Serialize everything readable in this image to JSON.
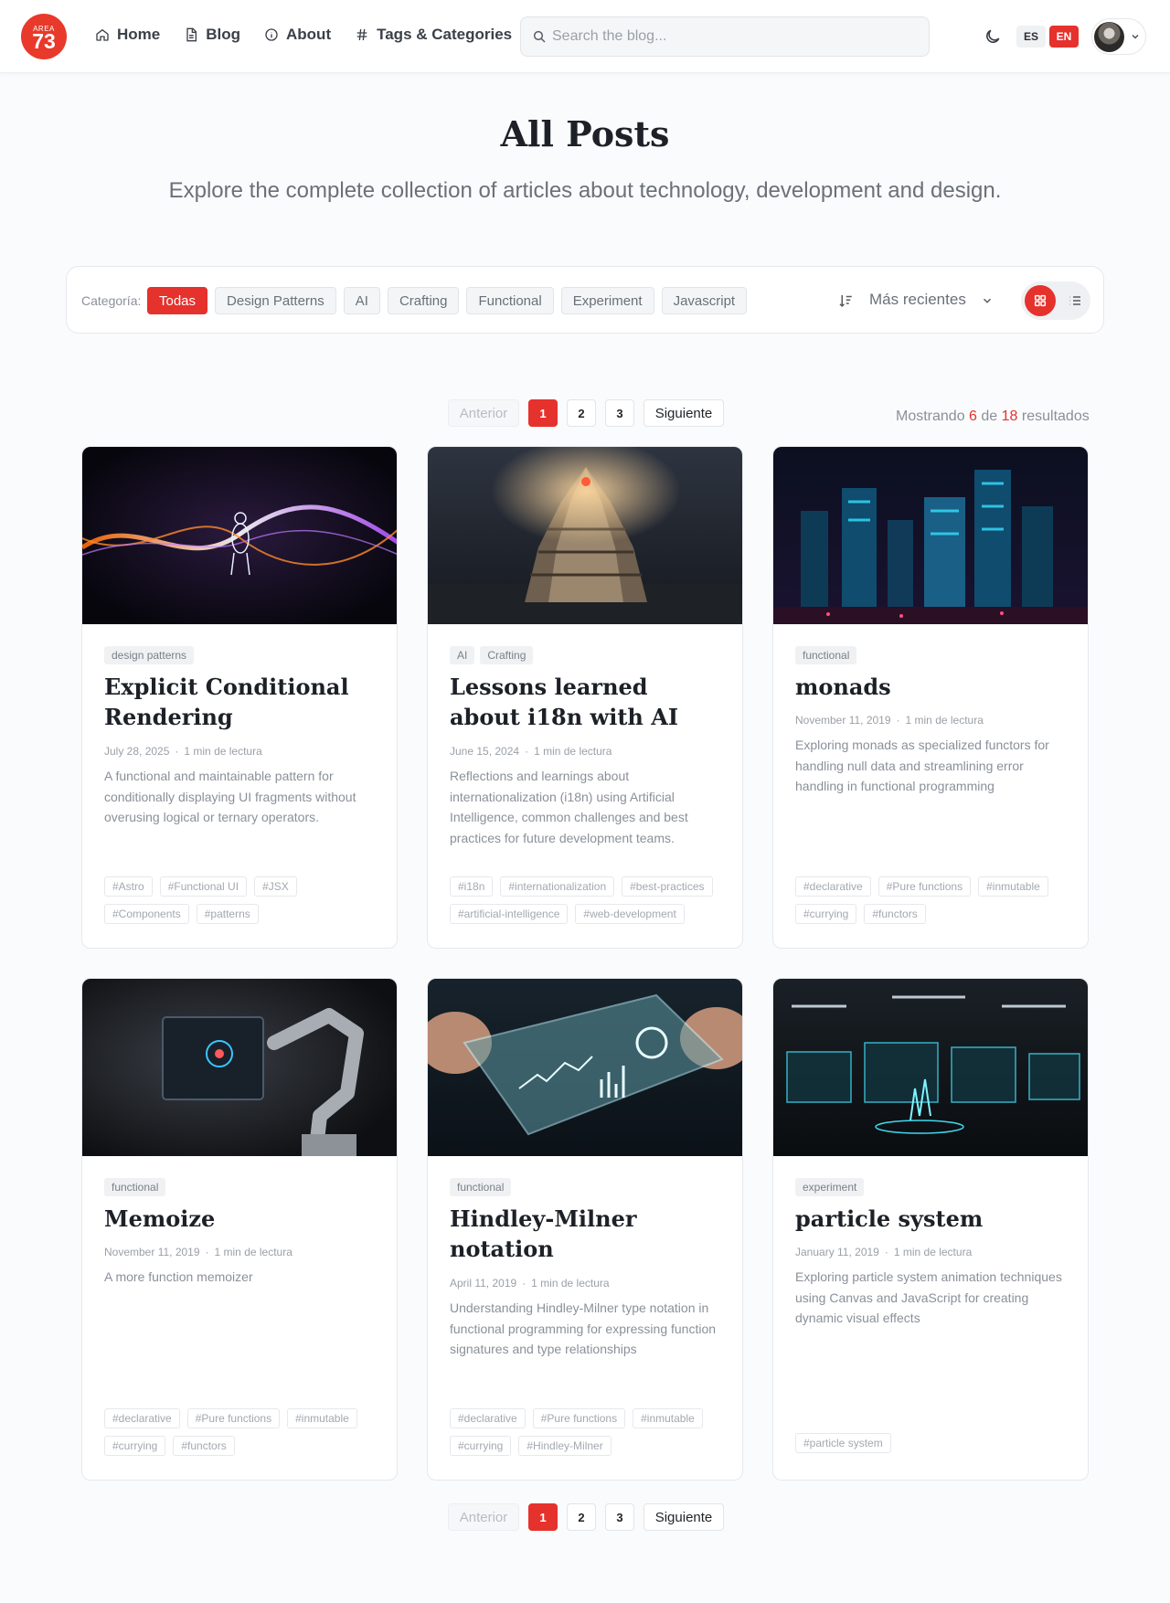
{
  "logo": {
    "small": "AREA",
    "number": "73"
  },
  "nav": [
    {
      "label": "Home",
      "icon": "home-icon"
    },
    {
      "label": "Blog",
      "icon": "document-icon"
    },
    {
      "label": "About",
      "icon": "info-icon"
    },
    {
      "label": "Tags & Categories",
      "icon": "hash-icon"
    }
  ],
  "search": {
    "placeholder": "Search the blog..."
  },
  "lang": {
    "es": "ES",
    "en": "EN",
    "active": "EN"
  },
  "hero": {
    "title": "All Posts",
    "subtitle": "Explore the complete collection of articles about technology, development and design."
  },
  "filter": {
    "label": "Categoría:",
    "chips": [
      "Todas",
      "Design Patterns",
      "AI",
      "Crafting",
      "Functional",
      "Experiment",
      "Javascript"
    ],
    "active": "Todas",
    "sort_label": "Más recientes",
    "view": "grid"
  },
  "pagination": {
    "prev": "Anterior",
    "pages": [
      "1",
      "2",
      "3"
    ],
    "current": "1",
    "next": "Siguiente"
  },
  "results": {
    "prefix": "Mostrando",
    "shown": "6",
    "middle": "de",
    "total": "18",
    "suffix": "resultados"
  },
  "colors": {
    "accent": "#e5322d",
    "text": "#1d2127",
    "muted": "#8a9099"
  },
  "posts": [
    {
      "categories": [
        "design patterns"
      ],
      "title": "Explicit Conditional Rendering",
      "date": "July 28, 2025",
      "read": "1 min de lectura",
      "excerpt": "A functional and maintainable pattern for conditionally displaying UI fragments without overusing logical or ternary operators.",
      "tags": [
        "#Astro",
        "#Functional UI",
        "#JSX",
        "#Components",
        "#patterns"
      ]
    },
    {
      "categories": [
        "AI",
        "Crafting"
      ],
      "title": "Lessons learned about i18n with AI",
      "date": "June 15, 2024",
      "read": "1 min de lectura",
      "excerpt": "Reflections and learnings about internationalization (i18n) using Artificial Intelligence, common challenges and best practices for future development teams.",
      "tags": [
        "#i18n",
        "#internationalization",
        "#best-practices",
        "#artificial-intelligence",
        "#web-development"
      ]
    },
    {
      "categories": [
        "functional"
      ],
      "title": "monads",
      "date": "November 11, 2019",
      "read": "1 min de lectura",
      "excerpt": "Exploring monads as specialized functors for handling null data and streamlining error handling in functional programming",
      "tags": [
        "#declarative",
        "#Pure functions",
        "#inmutable",
        "#currying",
        "#functors"
      ]
    },
    {
      "categories": [
        "functional"
      ],
      "title": "Memoize",
      "date": "November 11, 2019",
      "read": "1 min de lectura",
      "excerpt": "A more function memoizer",
      "tags": [
        "#declarative",
        "#Pure functions",
        "#inmutable",
        "#currying",
        "#functors"
      ]
    },
    {
      "categories": [
        "functional"
      ],
      "title": "Hindley-Milner notation",
      "date": "April 11, 2019",
      "read": "1 min de lectura",
      "excerpt": "Understanding Hindley-Milner type notation in functional programming for expressing function signatures and type relationships",
      "tags": [
        "#declarative",
        "#Pure functions",
        "#inmutable",
        "#currying",
        "#Hindley-Milner"
      ]
    },
    {
      "categories": [
        "experiment"
      ],
      "title": "particle system",
      "date": "January 11, 2019",
      "read": "1 min de lectura",
      "excerpt": "Exploring particle system animation techniques using Canvas and JavaScript for creating dynamic visual effects",
      "tags": [
        "#particle system"
      ]
    }
  ]
}
